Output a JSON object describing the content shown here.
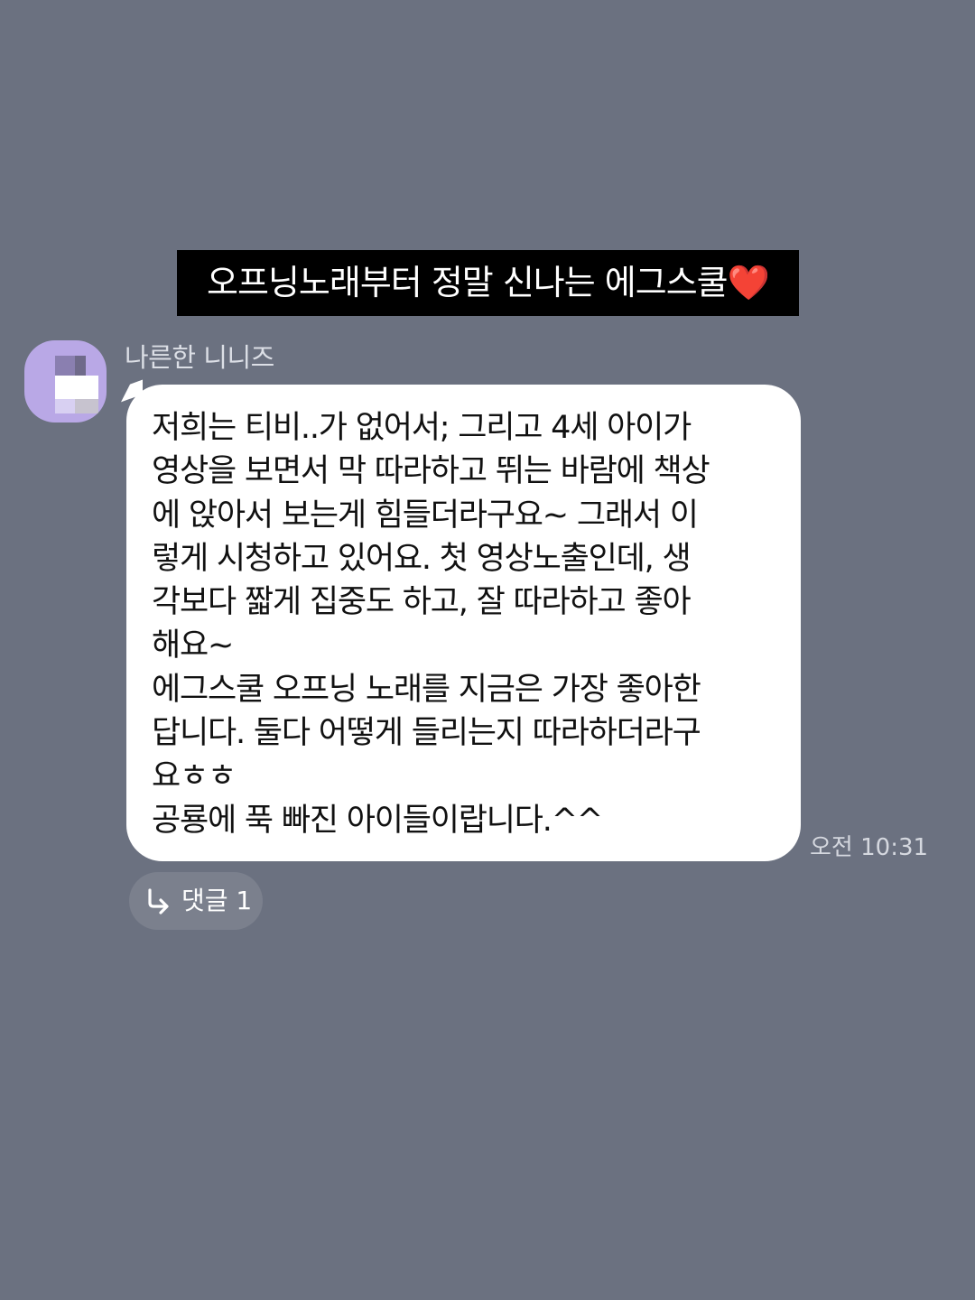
{
  "caption": {
    "text": "오프닝노래부터 정말 신나는 에그스쿨",
    "emoji": "❤️"
  },
  "message": {
    "sender_name": "나른한 니니즈",
    "avatar_icon": "blurred-profile-avatar",
    "lines": [
      "저희는 티비..가 없어서; 그리고 4세 아이가",
      "영상을 보면서 막 따라하고 뛰는 바람에 책상",
      "에 앉아서 보는게 힘들더라구요~ 그래서 이",
      "렇게 시청하고 있어요. 첫 영상노출인데, 생",
      "각보다 짧게 집중도 하고, 잘 따라하고 좋아",
      "해요~",
      "에그스쿨 오프닝 노래를 지금은 가장 좋아한",
      "답니다. 둘다 어떻게 들리는지 따라하더라구",
      "요ㅎㅎ",
      "공룡에 푹 빠진 아이들이랍니다.^^"
    ],
    "timestamp": "오전 10:31"
  },
  "reply": {
    "icon": "reply-arrow-icon",
    "label": "댓글 1"
  },
  "colors": {
    "background": "#6b7180",
    "bubble": "#ffffff",
    "caption_bg": "#000000",
    "avatar": "#b9a8e6",
    "reply_chip": "#7b808d"
  }
}
